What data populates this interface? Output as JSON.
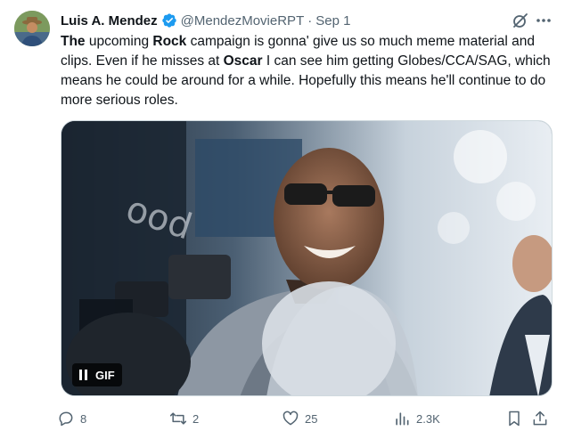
{
  "author": {
    "display_name": "Luis A. Mendez",
    "handle": "@MendezMovieRPT",
    "separator": "·",
    "date": "Sep 1",
    "avatar_icon": "user-avatar"
  },
  "tweet": {
    "segments": [
      {
        "text": "The",
        "bold": true
      },
      {
        "text": " upcoming ",
        "bold": false
      },
      {
        "text": "Rock",
        "bold": true
      },
      {
        "text": " campaign is gonna' give us so much meme material and clips. Even if he misses at ",
        "bold": false
      },
      {
        "text": "Oscar",
        "bold": true
      },
      {
        "text": " I can see him getting Globes/CCA/SAG, which means he could be around for a while. Hopefully this means he'll continue to do more serious roles.",
        "bold": false
      }
    ]
  },
  "media": {
    "type": "gif",
    "badge_label": "GIF",
    "pause_icon": "pause-icon"
  },
  "actions": {
    "replies": "8",
    "reposts": "2",
    "likes": "25",
    "views": "2.3K"
  },
  "colors": {
    "text": "#0f1419",
    "secondary": "#536471",
    "verified": "#1d9bf0",
    "border": "#cfd9de"
  }
}
